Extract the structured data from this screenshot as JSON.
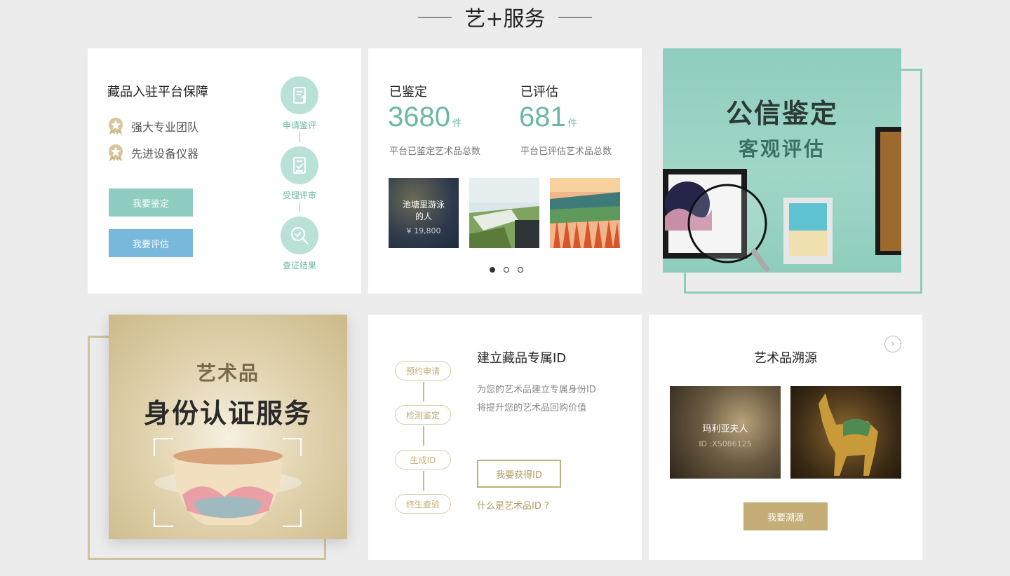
{
  "section": {
    "title": "艺+服务"
  },
  "guarantee": {
    "title": "藏品入驻平台保障",
    "features": [
      "强大专业团队",
      "先进设备仪器"
    ],
    "appraise_btn": "我要鉴定",
    "evaluate_btn": "我要评估",
    "steps": [
      "申请鉴评",
      "受理评审",
      "查证结果"
    ],
    "colors": {
      "appraise_btn": "#8ecdbf",
      "evaluate_btn": "#78b8db",
      "step_circle": "#b9e1d8"
    }
  },
  "stats": {
    "appraised": {
      "label": "已鉴定",
      "value": "3680",
      "unit": "件",
      "desc": "平台已鉴定艺术品总数"
    },
    "evaluated": {
      "label": "已评估",
      "value": "681",
      "unit": "件",
      "desc": "平台已评估艺术品总数"
    },
    "thumbs": [
      {
        "title_line1": "池塘里游泳",
        "title_line2": "的人",
        "price": "¥ 19,800"
      }
    ],
    "carousel": {
      "pages": 3,
      "active": 1
    }
  },
  "promo": {
    "title": "公信鉴定",
    "subtitle": "客观评估",
    "bg_color": "#8fcdbf"
  },
  "identity_banner": {
    "line1": "艺术品",
    "line2": "身份认证服务",
    "bg_color": "#d8c9a0"
  },
  "exclusive_id": {
    "steps": [
      "预约申请",
      "检测鉴定",
      "生成ID",
      "终生查验"
    ],
    "title": "建立藏品专属ID",
    "desc_line1": "为您的艺术品建立专属身份ID",
    "desc_line2": "将提升您的艺术品回购价值",
    "get_id_btn": "我要获得ID",
    "what_link": "什么是艺术品ID ?",
    "accent": "#c4ad76"
  },
  "provenance": {
    "title": "艺术品溯源",
    "items": [
      {
        "name": "玛利亚夫人",
        "id": "ID :XS086125"
      }
    ],
    "trace_btn": "我要溯源",
    "next_icon": "chevron-right-icon"
  }
}
